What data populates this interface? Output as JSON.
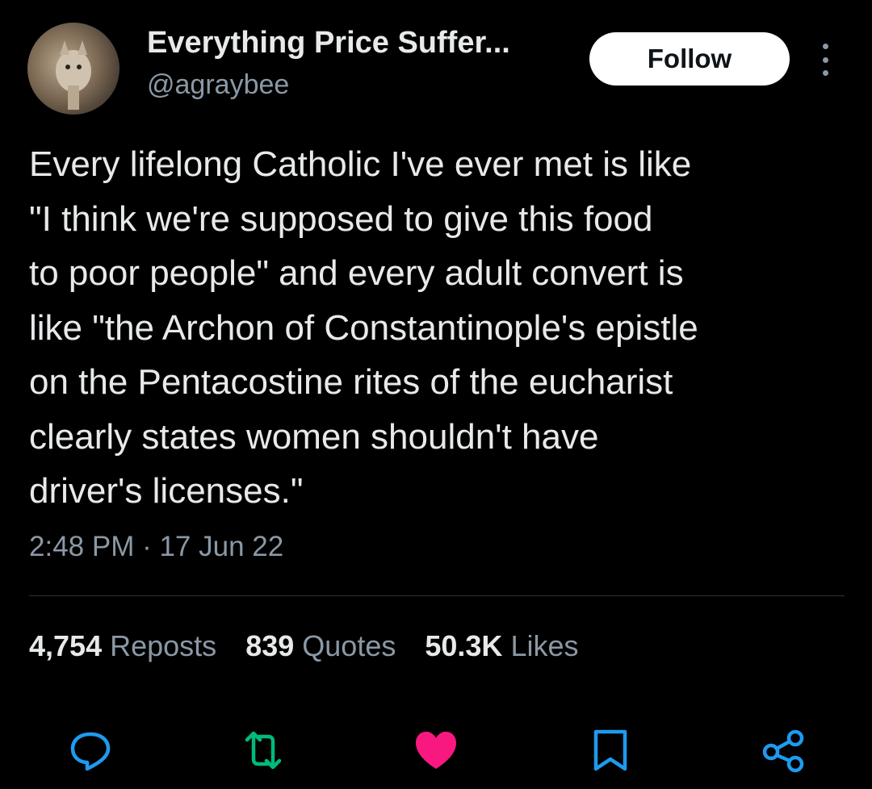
{
  "author": {
    "name": "Everything Price Suffer...",
    "handle": "@agraybee"
  },
  "header": {
    "follow_label": "Follow",
    "more_icon": "more-vertical-icon"
  },
  "tweet": {
    "lines": [
      "Every lifelong Catholic I've ever met is like",
      "\"I think we're supposed to give this food",
      "to poor people\" and every adult convert is",
      "like \"the Archon of Constantinople's epistle",
      "on the Pentacostine rites of the eucharist",
      "clearly states women shouldn't have",
      "driver's licenses.\""
    ],
    "timestamp": "2:48 PM · 17 Jun 22"
  },
  "stats": {
    "reposts_count": "4,754",
    "reposts_label": "Reposts",
    "quotes_count": "839",
    "quotes_label": "Quotes",
    "likes_count": "50.3K",
    "likes_label": "Likes"
  },
  "actions": {
    "icons": [
      "reply-icon",
      "repost-icon",
      "like-icon",
      "bookmark-icon",
      "share-icon"
    ],
    "liked": true
  },
  "colors": {
    "background": "#000000",
    "text": "#e7e9ea",
    "secondary": "#8b98a5",
    "like": "#f91880",
    "divider": "#2f3336"
  }
}
